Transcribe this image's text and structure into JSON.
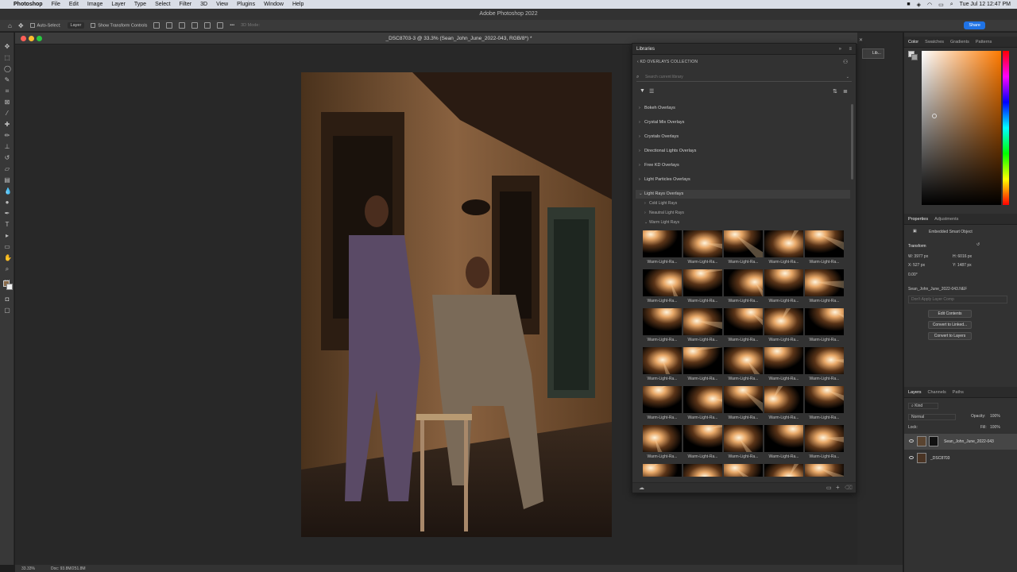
{
  "menubar": {
    "items": [
      "Photoshop",
      "File",
      "Edit",
      "Image",
      "Layer",
      "Type",
      "Select",
      "Filter",
      "3D",
      "View",
      "Plugins",
      "Window",
      "Help"
    ],
    "clock": "Tue Jul 12  12:47 PM"
  },
  "app": {
    "title": "Adobe Photoshop 2022"
  },
  "options": {
    "auto_select": "Auto-Select:",
    "layer": "Layer",
    "transform": "Show Transform Controls",
    "mode_3d": "3D Mode:",
    "share": "Share"
  },
  "document": {
    "tab": "_DSC8703-3 @ 33.3% (Sean_John_June_2022-043, RGB/8*) *",
    "zoom": "33.33%",
    "doc_size": "Doc: 93.8M/251.8M"
  },
  "libraries": {
    "tab": "Libraries",
    "collection": "KD OVERLAYS COLLECTION",
    "search_placeholder": "Search current library",
    "folders": [
      "Bokeh Overlays",
      "Crystal Mix Overlays",
      "Crystals Overlays",
      "Directional Lights Overlays",
      "Free KD Overlays",
      "Light Particles Overlays",
      "Light Rays Overlays"
    ],
    "subfolders": [
      "Cold Light Rays",
      "Neautral Light Rays",
      "Warm Light Rays"
    ],
    "thumb_label": "Warm-Light-Ra..."
  },
  "strip": {
    "libraries_label": "Lib..."
  },
  "color_panel": {
    "tabs": [
      "Color",
      "Swatches",
      "Gradients",
      "Patterns"
    ]
  },
  "properties": {
    "tabs": [
      "Properties",
      "Adjustments"
    ],
    "object_type": "Embedded Smart Object",
    "section": "Transform",
    "w": "W: 3977 px",
    "h": "H: 6016 px",
    "x": "X: 527 px",
    "y": "Y: 1487 px",
    "angle": "0.00°",
    "filename": "Sean_John_June_2022-043.NEF",
    "comps_placeholder": "Don't Apply Layer Comp",
    "buttons": [
      "Edit Contents",
      "Convert to Linked...",
      "Convert to Layers"
    ]
  },
  "layers": {
    "tabs": [
      "Layers",
      "Channels",
      "Paths"
    ],
    "kind": "Kind",
    "blend": "Normal",
    "opacity_label": "Opacity:",
    "opacity": "100%",
    "lock": "Lock:",
    "fill_label": "Fill:",
    "fill": "100%",
    "items": [
      "Sean_John_June_2022-043",
      "_DSC8703"
    ]
  },
  "colors": {
    "menubar_bg": "#d9dde6",
    "panel_bg": "#323232",
    "accent": "#1f73e6"
  }
}
